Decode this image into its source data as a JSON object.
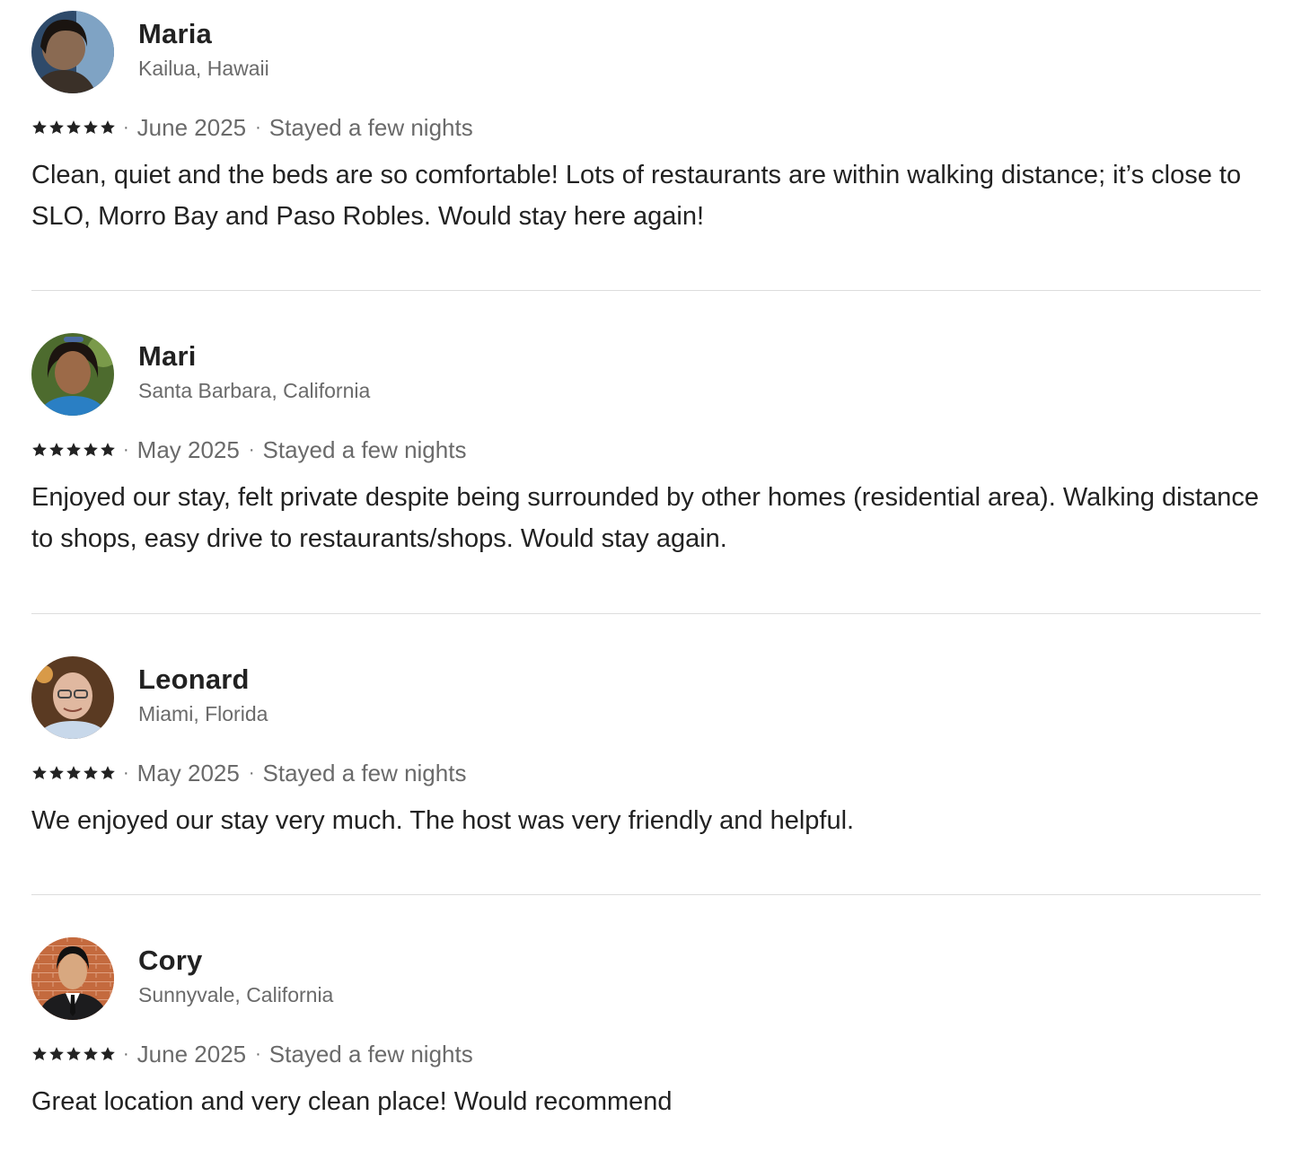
{
  "reviews": [
    {
      "name": "Maria",
      "location": "Kailua, Hawaii",
      "rating": 5,
      "date": "June 2025",
      "stay": "Stayed a few nights",
      "text": "Clean, quiet and the beds are so comfortable! Lots of restaurants are within walking distance; it’s close to SLO, Morro Bay and Paso Robles. Would stay here again!"
    },
    {
      "name": "Mari",
      "location": "Santa Barbara, California",
      "rating": 5,
      "date": "May 2025",
      "stay": "Stayed a few nights",
      "text": "Enjoyed our stay, felt private despite being surrounded by other homes (residential area). Walking distance to shops, easy drive to restaurants/shops. Would stay again."
    },
    {
      "name": "Leonard",
      "location": "Miami, Florida",
      "rating": 5,
      "date": "May 2025",
      "stay": "Stayed a few nights",
      "text": "We enjoyed our stay very much. The host was very friendly and helpful."
    },
    {
      "name": "Cory",
      "location": "Sunnyvale, California",
      "rating": 5,
      "date": "June 2025",
      "stay": "Stayed a few nights",
      "text": "Great location and very clean place! Would recommend"
    }
  ],
  "separator": "·",
  "colors": {
    "text_primary": "#222222",
    "text_secondary": "#6a6a6a",
    "divider": "#dddddd",
    "star": "#222222"
  },
  "icons": {
    "rating": "star-icon",
    "avatar": "user-photo"
  }
}
